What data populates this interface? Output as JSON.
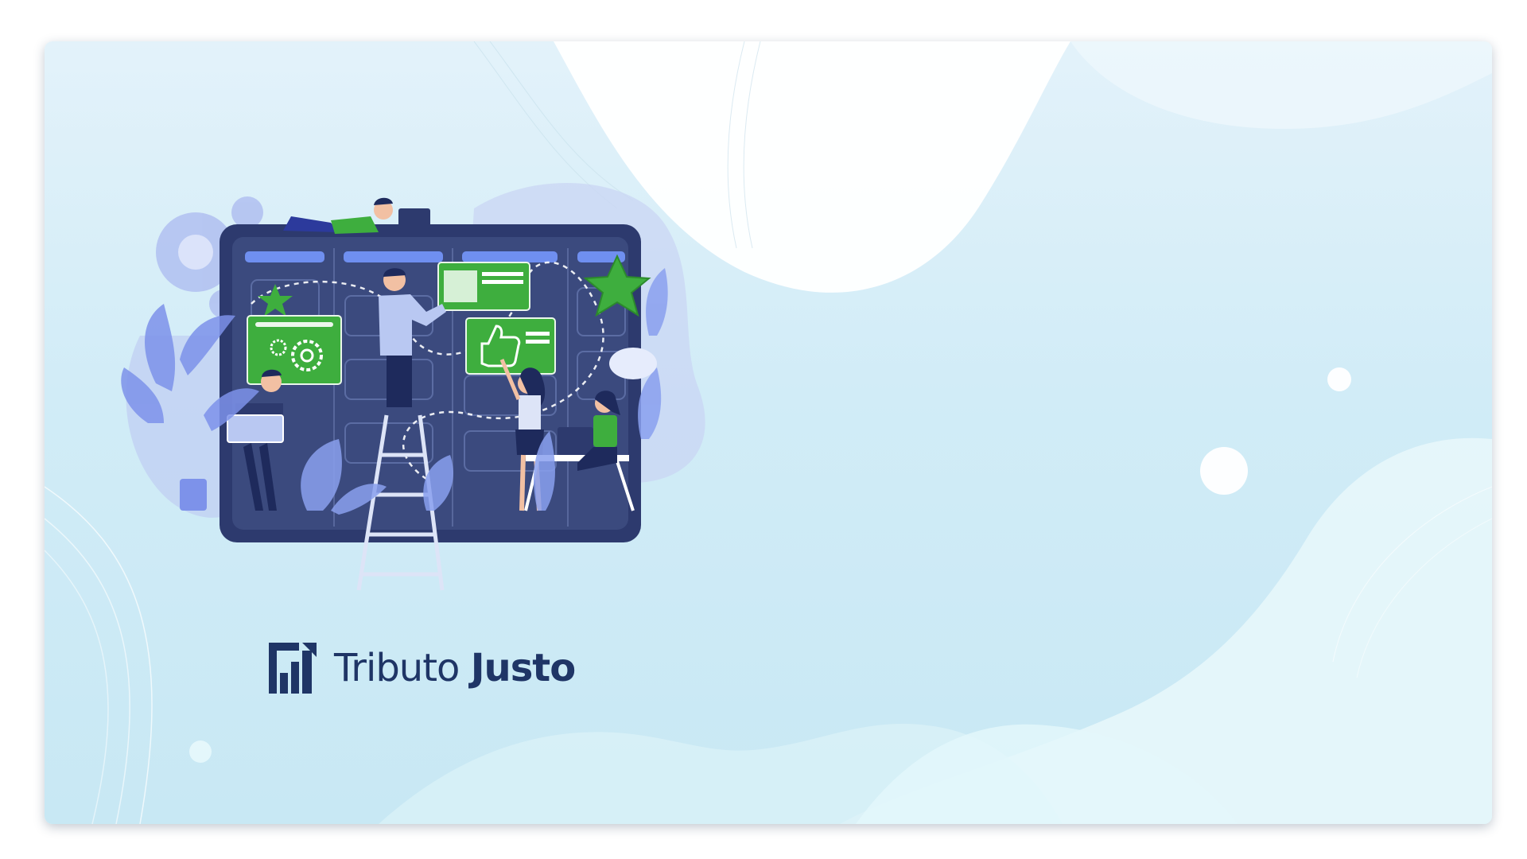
{
  "brand": {
    "name_part1": "Tributo",
    "name_part2": "Justo",
    "logo_icon": "bar-chart-rising-icon",
    "color_primary": "#1f3566"
  },
  "illustration": {
    "subject": "team-kanban-board-illustration",
    "accent_green": "#3eae3e",
    "board_color": "#3b4a7e",
    "icons": [
      "gears-icon",
      "thumbs-up-icon",
      "star-icon",
      "laptop-icon"
    ]
  },
  "colors": {
    "background_top": "#e3f2fa",
    "background_bottom": "#c8e8f4",
    "blob_white": "#ffffff"
  }
}
